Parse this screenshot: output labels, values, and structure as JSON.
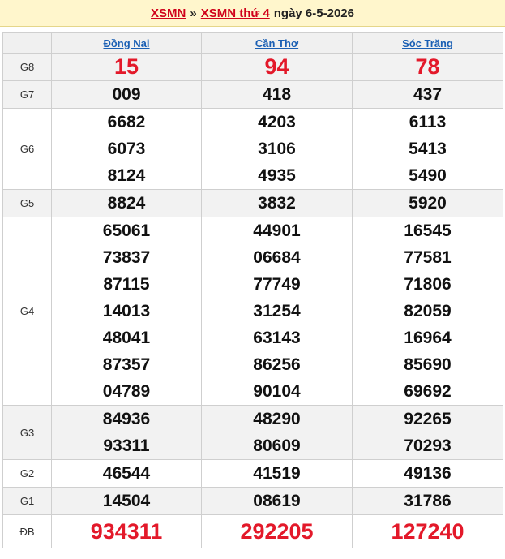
{
  "header": {
    "link1": "XSMN",
    "separator": "»",
    "link2": "XSMN thứ 4",
    "date_text": "ngày 6-5-2026"
  },
  "provinces": [
    "Đồng Nai",
    "Cần Thơ",
    "Sóc Trăng"
  ],
  "prizes": [
    {
      "label": "G8",
      "values": [
        [
          "15"
        ],
        [
          "94"
        ],
        [
          "78"
        ]
      ]
    },
    {
      "label": "G7",
      "values": [
        [
          "009"
        ],
        [
          "418"
        ],
        [
          "437"
        ]
      ]
    },
    {
      "label": "G6",
      "values": [
        [
          "6682",
          "6073",
          "8124"
        ],
        [
          "4203",
          "3106",
          "4935"
        ],
        [
          "6113",
          "5413",
          "5490"
        ]
      ]
    },
    {
      "label": "G5",
      "values": [
        [
          "8824"
        ],
        [
          "3832"
        ],
        [
          "5920"
        ]
      ]
    },
    {
      "label": "G4",
      "values": [
        [
          "65061",
          "73837",
          "87115",
          "14013",
          "48041",
          "87357",
          "04789"
        ],
        [
          "44901",
          "06684",
          "77749",
          "31254",
          "63143",
          "86256",
          "90104"
        ],
        [
          "16545",
          "77581",
          "71806",
          "82059",
          "16964",
          "85690",
          "69692"
        ]
      ]
    },
    {
      "label": "G3",
      "values": [
        [
          "84936",
          "93311"
        ],
        [
          "48290",
          "80609"
        ],
        [
          "92265",
          "70293"
        ]
      ]
    },
    {
      "label": "G2",
      "values": [
        [
          "46544"
        ],
        [
          "41519"
        ],
        [
          "49136"
        ]
      ]
    },
    {
      "label": "G1",
      "values": [
        [
          "14504"
        ],
        [
          "08619"
        ],
        [
          "31786"
        ]
      ]
    },
    {
      "label": "ĐB",
      "values": [
        [
          "934311"
        ],
        [
          "292205"
        ],
        [
          "127240"
        ]
      ]
    }
  ]
}
